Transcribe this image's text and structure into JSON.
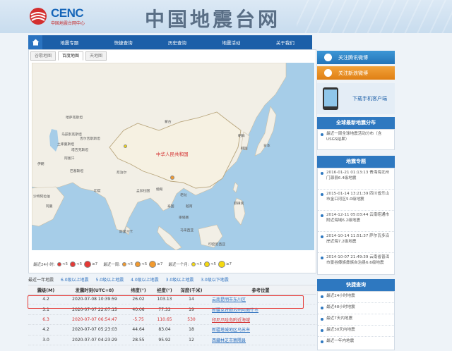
{
  "header": {
    "logo_text": "CENC",
    "logo_sub": "中国地震台网中心",
    "site_title": "中国地震台网"
  },
  "nav": {
    "items": [
      "地震专题",
      "快捷查询",
      "历史查询",
      "地震活动",
      "关于我们"
    ]
  },
  "map": {
    "tabs": [
      "谷歌地图",
      "百度地图",
      "天地图"
    ],
    "active_tab": "百度地图",
    "places": [
      {
        "id": "mongolia",
        "label": "蒙古"
      },
      {
        "id": "china",
        "label": "中华人民共和国"
      },
      {
        "id": "japan",
        "label": "日本"
      },
      {
        "id": "kazakhstan",
        "label": "哈萨克斯坦"
      },
      {
        "id": "uzbekistan",
        "label": "乌兹别克斯坦"
      },
      {
        "id": "turkmenistan",
        "label": "土库曼斯坦"
      },
      {
        "id": "iran",
        "label": "伊朗"
      },
      {
        "id": "afghanistan",
        "label": "阿富汗"
      },
      {
        "id": "pakistan",
        "label": "巴基斯坦"
      },
      {
        "id": "india",
        "label": "印度"
      },
      {
        "id": "nepal",
        "label": "尼泊尔"
      },
      {
        "id": "myanmar",
        "label": "缅甸"
      },
      {
        "id": "laos",
        "label": "老挝"
      },
      {
        "id": "thailand",
        "label": "泰国"
      },
      {
        "id": "vietnam",
        "label": "越南"
      },
      {
        "id": "cambodia",
        "label": "柬埔寨"
      },
      {
        "id": "philippines",
        "label": "菲律宾"
      },
      {
        "id": "malaysia",
        "label": "马来西亚"
      },
      {
        "id": "indonesia",
        "label": "印度尼西亚"
      },
      {
        "id": "skorea",
        "label": "韩国"
      },
      {
        "id": "nkorea",
        "label": "朝鲜"
      },
      {
        "id": "srilanka",
        "label": "斯里兰卡"
      },
      {
        "id": "bangladesh",
        "label": "孟加拉国"
      },
      {
        "id": "kyrgyz",
        "label": "吉尔吉斯斯坦"
      },
      {
        "id": "tajik",
        "label": "塔吉克斯坦"
      },
      {
        "id": "oman",
        "label": "阿曼"
      },
      {
        "id": "saudi",
        "label": "沙特阿拉伯"
      }
    ],
    "legend": [
      {
        "label": "最近24小时:",
        "items": [
          {
            "text": "<5",
            "color": "#e53935"
          },
          {
            "text": "<5",
            "color": "#e53935"
          },
          {
            "text": "≥7",
            "color": "#e53935"
          }
        ]
      },
      {
        "label": "最近一周:",
        "items": [
          {
            "text": "<5",
            "color": "#f29a2e"
          },
          {
            "text": "<5",
            "color": "#f29a2e"
          },
          {
            "text": "≥7",
            "color": "#f29a2e"
          }
        ]
      },
      {
        "label": "最近一个月:",
        "items": [
          {
            "text": "<5",
            "color": "#f5d90f"
          },
          {
            "text": "<5",
            "color": "#f5d90f"
          },
          {
            "text": "≥7",
            "color": "#f5d90f"
          }
        ]
      }
    ]
  },
  "filters": {
    "label": "最近一年地震",
    "links": [
      "6.0级以上地震",
      "5.0级以上地震",
      "4.0级以上地震",
      "3.0级以上地震",
      "3.0级以下地震"
    ]
  },
  "table": {
    "headers": [
      "震级(M)",
      "发震时刻(UTC+8)",
      "纬度(°)",
      "经度(°)",
      "深度(千米)",
      "参考位置"
    ],
    "rows": [
      {
        "mag": "4.2",
        "time": "2020-07-08 10:39:59",
        "lat": "26.02",
        "lon": "103.13",
        "depth": "14",
        "place": "云南昆明市东川区",
        "red": false
      },
      {
        "mag": "3.1",
        "time": "2020-07-07 22:07:15",
        "lat": "40.06",
        "lon": "77.33",
        "depth": "19",
        "place": "新疆克孜勒苏州阿图什市",
        "red": false
      },
      {
        "mag": "6.3",
        "time": "2020-07-07 06:54:47",
        "lat": "-5.75",
        "lon": "110.65",
        "depth": "530",
        "place": "印尼爪哇岛附近海域",
        "red": true
      },
      {
        "mag": "4.2",
        "time": "2020-07-07 05:23:03",
        "lat": "44.64",
        "lon": "83.04",
        "depth": "18",
        "place": "新疆塔城地区乌苏市",
        "red": false
      },
      {
        "mag": "3.0",
        "time": "2020-07-07 04:23:29",
        "lat": "28.55",
        "lon": "95.92",
        "depth": "12",
        "place": "西藏林芝市察隅县",
        "red": false
      }
    ]
  },
  "sidebar": {
    "btn_tencent": "关注腾讯微博",
    "btn_sina": "关注新浪微博",
    "btn_app": "下载手机客户端",
    "global_title": "全球最新地震分布",
    "global_items": [
      "最近一周全球地震活动分布（含USGS结果）"
    ],
    "topic_title": "地震专题",
    "topic_items": [
      "2016-01-21 01:13:13 青海海北州门源县6.4级地震",
      "2015-01-14 13:21:39 四川省乐山市金口河区5.0级地震",
      "2014-12-11 05:03:44 云南昭通市附近海域6.2级地震",
      "2014-10-14 11:51:37 萨尔瓦多沿岸近海7.2级地震",
      "2014-10-07 21:49:39 云南省普洱市景谷傣族彝族自治县6.6级地震"
    ],
    "quick_title": "快捷查询",
    "quick_items": [
      "最近24小时地震",
      "最近48小时地震",
      "最近7天内地震",
      "最近30天内地震",
      "最近一年内地震"
    ]
  }
}
